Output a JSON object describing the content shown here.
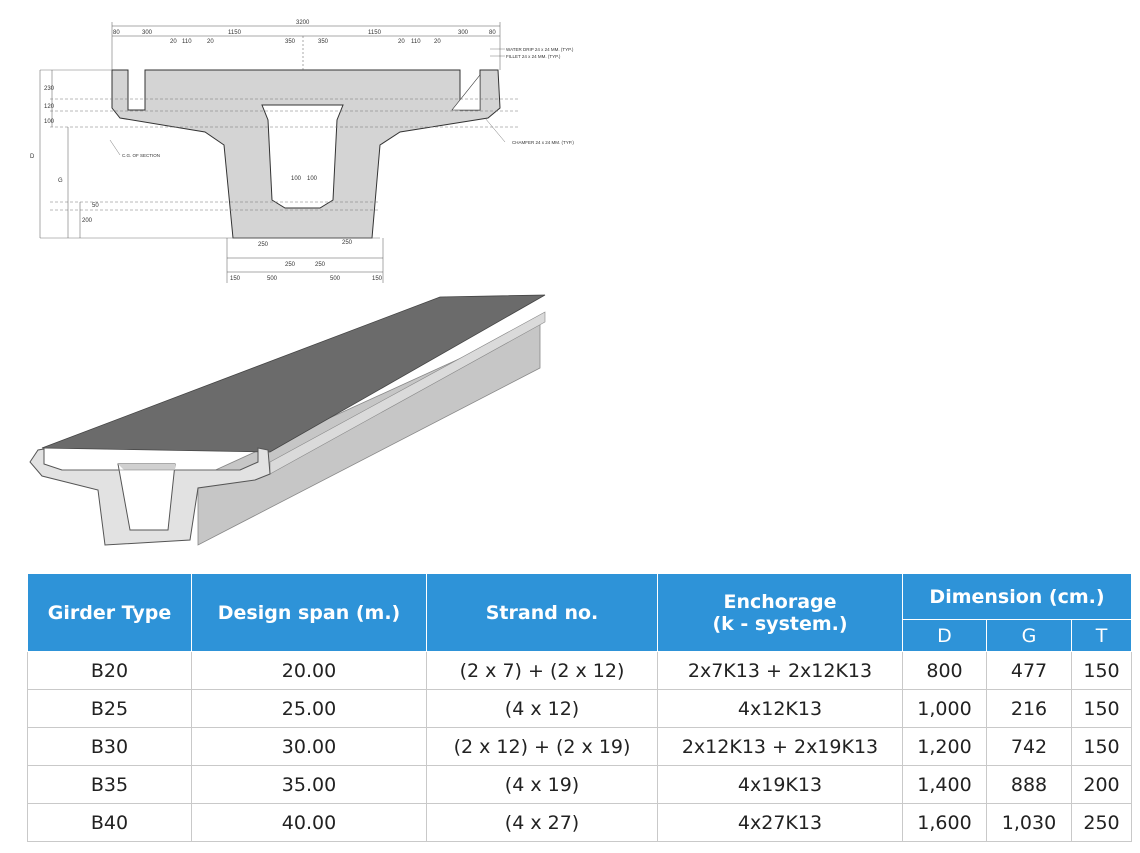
{
  "drawing": {
    "dims_top": [
      "3200",
      "80",
      "300",
      "1150",
      "20",
      "110",
      "20",
      "350",
      "350",
      "1150",
      "20",
      "110",
      "20",
      "300",
      "80"
    ],
    "dims_bottom": [
      "150",
      "500",
      "250",
      "250",
      "500",
      "150"
    ],
    "dims_inner": [
      "100",
      "100",
      "250",
      "250"
    ],
    "dims_left": [
      "D",
      "G",
      "100",
      "120",
      "230",
      "200",
      "50"
    ],
    "notes": {
      "water_drip": "WATER DRIP 24 x 24 MM. (TYP.)",
      "fillet": "FILLET 24 x 24 MM. (TYP.)",
      "chamfer": "CHAMFER 24 x 24 MM. (TYP.)",
      "cg": "C.G. OF SECTION"
    }
  },
  "table": {
    "headers": {
      "girder_type": "Girder Type",
      "design_span": "Design span (m.)",
      "strand_no": "Strand no.",
      "enchorage_line1": "Enchorage",
      "enchorage_line2": "(k - system.)",
      "dimension": "Dimension (cm.)",
      "d": "D",
      "g": "G",
      "t": "T"
    },
    "rows": [
      {
        "type": "B20",
        "span": "20.00",
        "strand": "(2 x 7) + (2 x 12)",
        "anchor": "2x7K13 + 2x12K13",
        "d": "800",
        "g": "477",
        "t": "150"
      },
      {
        "type": "B25",
        "span": "25.00",
        "strand": "(4 x 12)",
        "anchor": "4x12K13",
        "d": "1,000",
        "g": "216",
        "t": "150"
      },
      {
        "type": "B30",
        "span": "30.00",
        "strand": "(2 x 12) + (2 x 19)",
        "anchor": "2x12K13 + 2x19K13",
        "d": "1,200",
        "g": "742",
        "t": "150"
      },
      {
        "type": "B35",
        "span": "35.00",
        "strand": "(4 x 19)",
        "anchor": "4x19K13",
        "d": "1,400",
        "g": "888",
        "t": "200"
      },
      {
        "type": "B40",
        "span": "40.00",
        "strand": "(4 x 27)",
        "anchor": "4x27K13",
        "d": "1,600",
        "g": "1,030",
        "t": "250"
      }
    ]
  },
  "colors": {
    "header_bg": "#2e93d8",
    "concrete": "#d4d4d4",
    "deck": "#6b6b6b"
  }
}
